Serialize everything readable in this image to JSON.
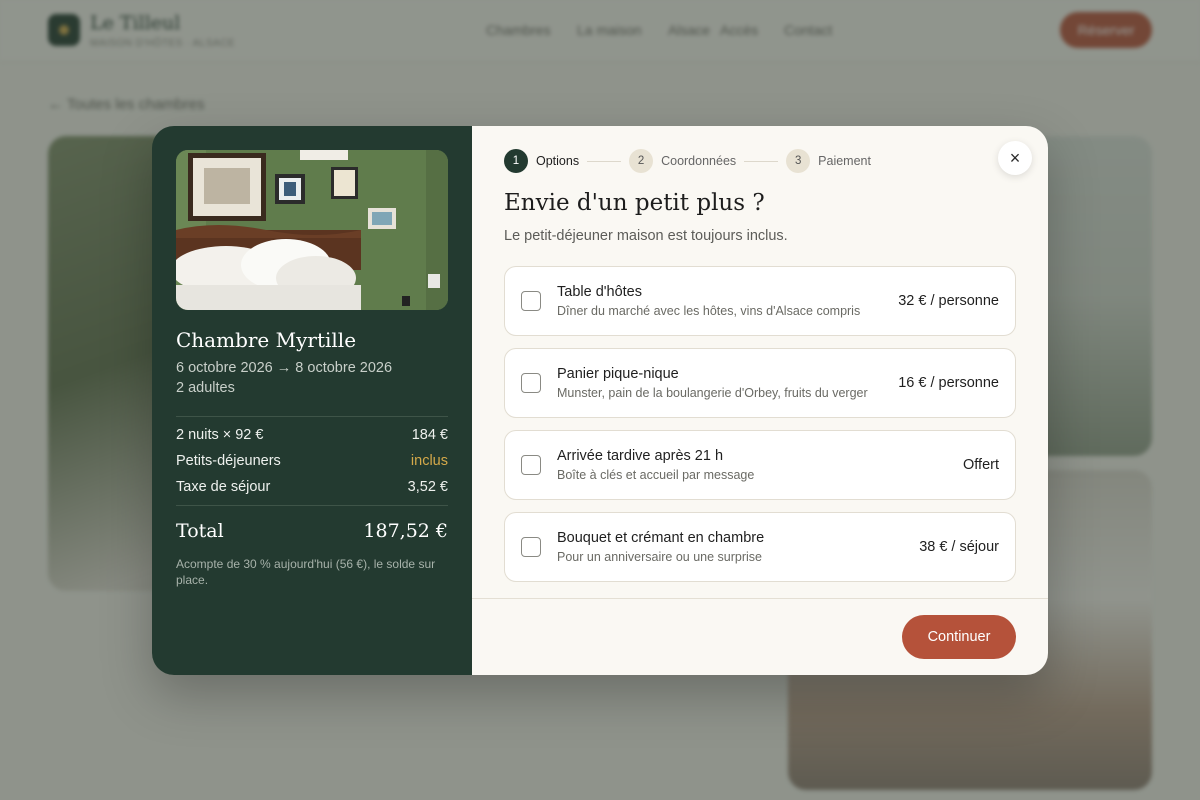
{
  "background": {
    "brand_name": "Le Tilleul",
    "brand_sub": "MAISON D'HÔTES · ALSACE",
    "nav": [
      "Chambres",
      "La maison",
      "Alsace",
      "Accès",
      "Contact"
    ],
    "reserve_label": "Réserver",
    "back_label": "← Toutes les chambres"
  },
  "summary": {
    "room_name": "Chambre Myrtille",
    "dates": "6 octobre 2026 → 8 octobre 2026",
    "guests": "2 adultes",
    "lines": [
      {
        "label": "2 nuits × 92 €",
        "value": "184 €"
      },
      {
        "label": "Petits-déjeuners",
        "value": "inclus"
      },
      {
        "label": "Taxe de séjour",
        "value": "3,52 €"
      }
    ],
    "total_label": "Total",
    "total_value": "187,52 €",
    "deposit_note": "Acompte de 30 % aujourd'hui (56 €), le solde sur place."
  },
  "stepper": [
    {
      "num": "1",
      "label": "Options"
    },
    {
      "num": "2",
      "label": "Coordonnées"
    },
    {
      "num": "3",
      "label": "Paiement"
    }
  ],
  "panel": {
    "title": "Envie d'un petit plus ?",
    "subtitle": "Le petit-déjeuner maison est toujours inclus.",
    "continue_label": "Continuer",
    "close_icon": "×"
  },
  "options": [
    {
      "title": "Table d'hôtes",
      "desc": "Dîner du marché avec les hôtes, vins d'Alsace compris",
      "price": "32 € / personne"
    },
    {
      "title": "Panier pique-nique",
      "desc": "Munster, pain de la boulangerie d'Orbey, fruits du verger",
      "price": "16 € / personne"
    },
    {
      "title": "Arrivée tardive après 21 h",
      "desc": "Boîte à clés et accueil par message",
      "price": "Offert"
    },
    {
      "title": "Bouquet et crémant en chambre",
      "desc": "Pour un anniversaire ou une surprise",
      "price": "38 € / séjour"
    }
  ],
  "colors": {
    "accent": "#b5523a",
    "dark_green": "#233a30",
    "gold": "#d4a94a"
  }
}
